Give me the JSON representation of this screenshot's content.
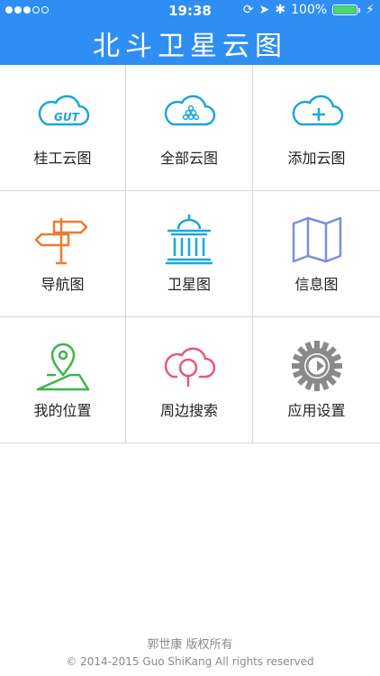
{
  "status_bar": {
    "time": "19:38",
    "battery": "100%",
    "signal_dots": 3
  },
  "header": {
    "title": "北斗卫星云图"
  },
  "grid": [
    {
      "label": "桂工云图",
      "icon": "cloud-logo-icon",
      "color": "#1aa7d8"
    },
    {
      "label": "全部云图",
      "icon": "cloud-dots-icon",
      "color": "#1aa7d8"
    },
    {
      "label": "添加云图",
      "icon": "cloud-plus-icon",
      "color": "#1aa7d8"
    },
    {
      "label": "导航图",
      "icon": "signpost-icon",
      "color": "#ee7a2f"
    },
    {
      "label": "卫星图",
      "icon": "building-icon",
      "color": "#1aa7d8"
    },
    {
      "label": "信息图",
      "icon": "map-icon",
      "color": "#7a8fe0"
    },
    {
      "label": "我的位置",
      "icon": "location-pin-icon",
      "color": "#3cb54a"
    },
    {
      "label": "周边搜索",
      "icon": "cloud-search-icon",
      "color": "#e9577a"
    },
    {
      "label": "应用设置",
      "icon": "gear-icon",
      "color": "#8a8a8a"
    }
  ],
  "footer": {
    "owner": "郭世康 版权所有",
    "copyright": "© 2014-2015 Guo ShiKang All rights reserved"
  },
  "colors": {
    "header_bg": "#2f8ef3"
  }
}
